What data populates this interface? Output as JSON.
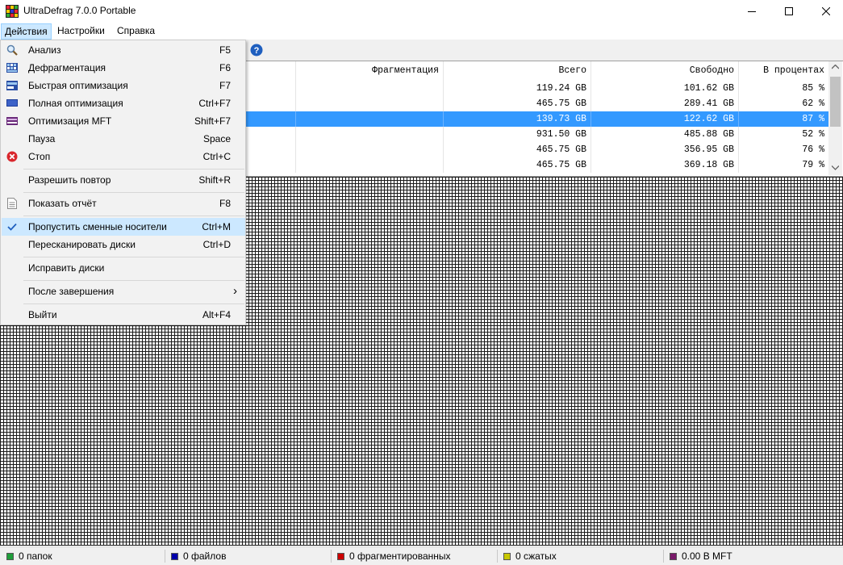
{
  "window": {
    "title": "UltraDefrag 7.0.0 Portable"
  },
  "menubar": {
    "actions": "Действия",
    "settings": "Настройки",
    "help": "Справка"
  },
  "drives": {
    "headers": {
      "fragmentation": "Фрагментация",
      "total": "Всего",
      "free": "Свободно",
      "percent": "В процентах"
    },
    "rows": [
      {
        "total": "119.24 GB",
        "free": "101.62 GB",
        "percent": "85 %",
        "selected": false
      },
      {
        "total": "465.75 GB",
        "free": "289.41 GB",
        "percent": "62 %",
        "selected": false
      },
      {
        "total": "139.73 GB",
        "free": "122.62 GB",
        "percent": "87 %",
        "selected": true
      },
      {
        "total": "931.50 GB",
        "free": "485.88 GB",
        "percent": "52 %",
        "selected": false
      },
      {
        "total": "465.75 GB",
        "free": "356.95 GB",
        "percent": "76 %",
        "selected": false
      },
      {
        "total": "465.75 GB",
        "free": "369.18 GB",
        "percent": "79 %",
        "selected": false
      }
    ]
  },
  "menu": {
    "analyze": {
      "label": "Анализ",
      "key": "F5",
      "icon": "magnifier-icon"
    },
    "defrag": {
      "label": "Дефрагментация",
      "key": "F6",
      "icon": "defrag-icon"
    },
    "quick_optimize": {
      "label": "Быстрая оптимизация",
      "key": "F7",
      "icon": "quick-optimize-icon"
    },
    "full_optimize": {
      "label": "Полная оптимизация",
      "key": "Ctrl+F7",
      "icon": "full-optimize-icon"
    },
    "mft_optimize": {
      "label": "Оптимизация MFT",
      "key": "Shift+F7",
      "icon": "mft-optimize-icon"
    },
    "pause": {
      "label": "Пауза",
      "key": "Space"
    },
    "stop": {
      "label": "Стоп",
      "key": "Ctrl+C",
      "icon": "stop-icon"
    },
    "repeat": {
      "label": "Разрешить повтор",
      "key": "Shift+R"
    },
    "report": {
      "label": "Показать отчёт",
      "key": "F8",
      "icon": "report-icon"
    },
    "skip_removable": {
      "label": "Пропустить сменные носители",
      "key": "Ctrl+M",
      "checked": true
    },
    "rescan": {
      "label": "Пересканировать диски",
      "key": "Ctrl+D"
    },
    "repair": {
      "label": "Исправить диски"
    },
    "after_finish": {
      "label": "После завершения",
      "arrow": "›"
    },
    "exit": {
      "label": "Выйти",
      "key": "Alt+F4"
    }
  },
  "status": {
    "folders": "0 папок",
    "files": "0 файлов",
    "fragmented": "0 фрагментированных",
    "compressed": "0 сжатых",
    "mft": "0.00 B MFT"
  },
  "colors": {
    "selection": "#3399ff",
    "folders": "#1f9e3a",
    "files": "#0000aa",
    "fragmented": "#cc0000",
    "compressed": "#c8c800",
    "mft": "#7a1a6a"
  }
}
